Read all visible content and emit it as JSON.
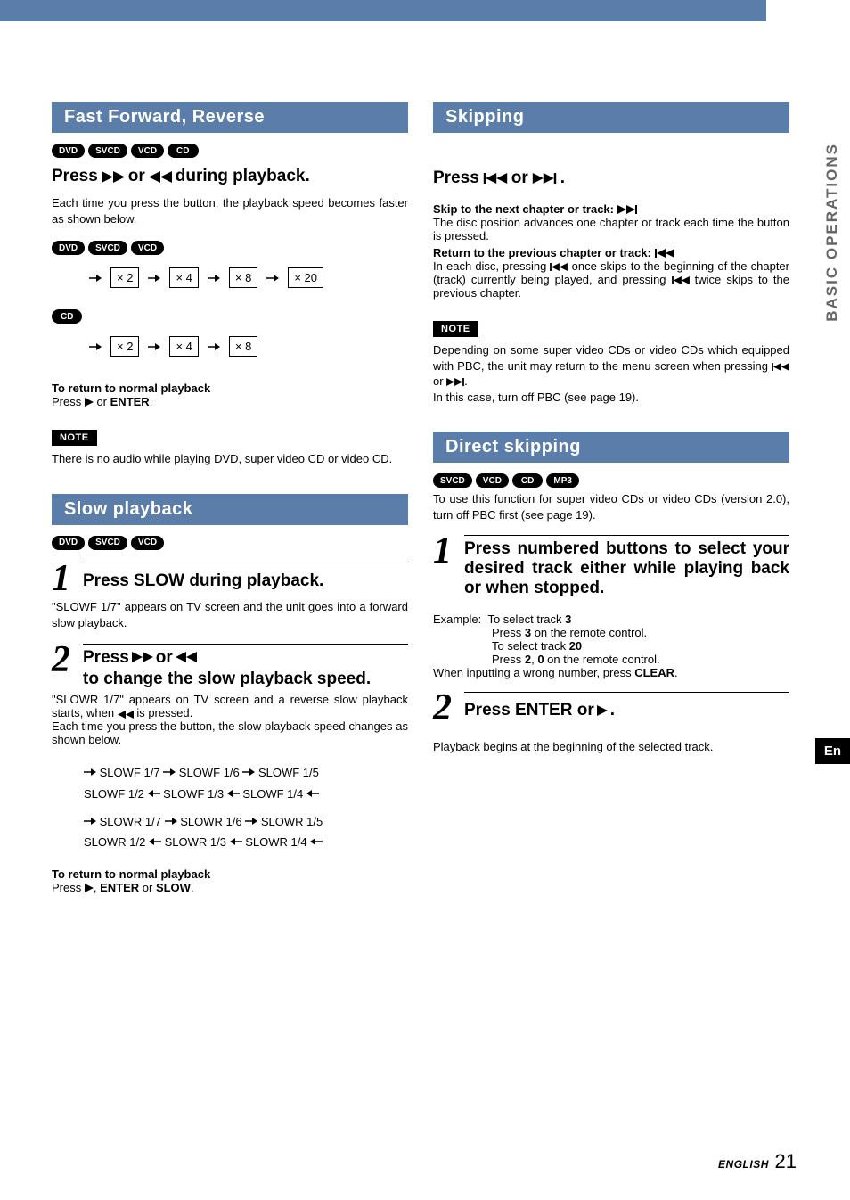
{
  "sidebar": {
    "title": "BASIC OPERATIONS"
  },
  "langTab": "En",
  "footer": {
    "label": "ENGLISH",
    "page": "21"
  },
  "left": {
    "ffr": {
      "title": "Fast Forward, Reverse",
      "badges": [
        "DVD",
        "SVCD",
        "VCD",
        "CD"
      ],
      "sub_pre": "Press ",
      "sub_mid": " or ",
      "sub_post": " during playback.",
      "body": "Each time you press the button, the playback speed becomes faster as shown below.",
      "badges2": [
        "DVD",
        "SVCD",
        "VCD"
      ],
      "row1": [
        "× 2",
        "× 4",
        "× 8",
        "× 20"
      ],
      "badges3": [
        "CD"
      ],
      "row2": [
        "× 2",
        "× 4",
        "× 8"
      ],
      "ret_head": "To return to normal playback",
      "ret_body_pre": "Press ",
      "ret_body_post": " or ",
      "enter": "ENTER",
      "period": ".",
      "note_label": "NOTE",
      "note_text": "There is no audio while playing DVD, super video CD or video CD."
    },
    "slow": {
      "title": "Slow playback",
      "badges": [
        "DVD",
        "SVCD",
        "VCD"
      ],
      "step1_num": "1",
      "step1_head": "Press SLOW during playback.",
      "step1_body": "\"SLOWF 1/7\" appears on TV screen and the unit goes into a forward slow playback.",
      "step2_num": "2",
      "step2_head_pre": "Press ",
      "step2_head_mid": " or ",
      "step2_head_post": " to change the slow playback speed.",
      "step2_body_l1_pre": "\"SLOWR 1/7\" appears on TV screen and a reverse slow playback starts, when ",
      "step2_body_l1_post": " is pressed.",
      "step2_body_l2": "Each time you press the button, the slow playback speed changes as shown below.",
      "chain_f": [
        "SLOWF 1/7",
        "SLOWF 1/6",
        "SLOWF 1/5",
        "SLOWF 1/2",
        "SLOWF 1/3",
        "SLOWF 1/4"
      ],
      "chain_r": [
        "SLOWR 1/7",
        "SLOWR 1/6",
        "SLOWR 1/5",
        "SLOWR 1/2",
        "SLOWR 1/3",
        "SLOWR 1/4"
      ],
      "ret_head": "To return to normal playback",
      "ret_body_pre": "Press ",
      "ret_comma": ", ",
      "enter": "ENTER",
      "or": " or ",
      "slow": "SLOW",
      "period": "."
    }
  },
  "right": {
    "skip": {
      "title": "Skipping",
      "sub_pre": "Press ",
      "sub_mid": " or ",
      "sub_post": ".",
      "next_head": "Skip to the next chapter or track: ",
      "next_body": "The disc position advances one chapter or track each time the button is pressed.",
      "prev_head": "Return to the previous chapter or track: ",
      "prev_body_l1_pre": "In each disc, pressing ",
      "prev_body_l1_post": " once skips to the beginning of the chapter (track) currently being played, and pressing ",
      "prev_body_l2_post": " twice skips to the previous chapter.",
      "note_label": "NOTE",
      "note_body_l1": "Depending on some super video CDs or video CDs which equipped with PBC, the unit may return to the menu screen when pressing ",
      "note_body_mid": " or ",
      "note_body_end": ".",
      "note_body_l2": "In this case, turn off PBC (see page 19)."
    },
    "direct": {
      "title": "Direct skipping",
      "badges": [
        "SVCD",
        "VCD",
        "CD",
        "MP3"
      ],
      "intro": "To use this function for super video CDs or video CDs (version 2.0), turn off PBC first (see page 19).",
      "step1_num": "1",
      "step1_head": "Press numbered buttons to select your desired track either while playing back or when stopped.",
      "ex_label": "Example:",
      "ex_sel3": "To select track ",
      "ex_3": "3",
      "ex_press3_pre": "Press ",
      "ex_press3_post": " on the remote control.",
      "ex_sel20": "To select track ",
      "ex_20": "20",
      "ex_press20_pre": "Press ",
      "ex_2": "2",
      "ex_comma": ", ",
      "ex_0": "0",
      "ex_press20_post": " on the remote control.",
      "wrong_pre": "When inputting a wrong number, press ",
      "clear": "CLEAR",
      "period": ".",
      "step2_num": "2",
      "step2_head_pre": "Press ENTER or ",
      "step2_head_post": ".",
      "step2_body": "Playback begins at the beginning of the selected track."
    }
  }
}
